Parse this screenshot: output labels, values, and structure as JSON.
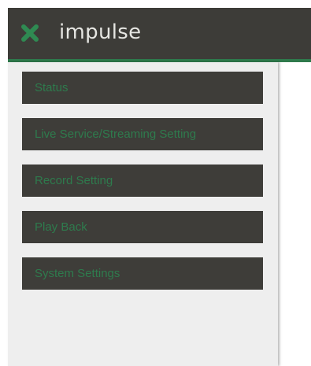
{
  "app": {
    "title": "impulse",
    "close_icon": "close-x-icon",
    "header_color": "#3d3c38",
    "accent_color": "#2f7a4c"
  },
  "sidebar": {
    "items": [
      {
        "label": "Status"
      },
      {
        "label": "Live Service/Streaming Setting"
      },
      {
        "label": "Record Setting"
      },
      {
        "label": "Play Back"
      },
      {
        "label": "System Settings"
      }
    ],
    "item_text_color": "#2e7b4d",
    "item_bg_color": "#3e3d39"
  }
}
